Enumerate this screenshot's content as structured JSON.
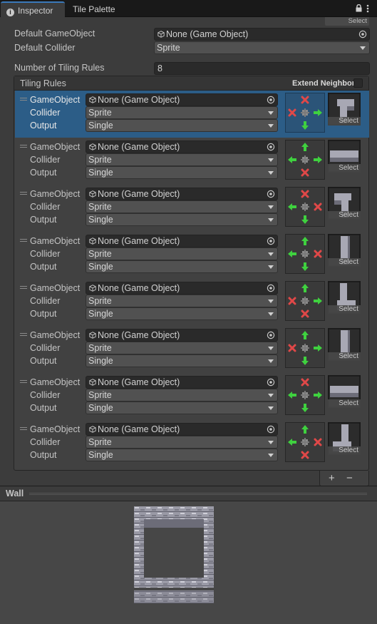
{
  "tabs": [
    {
      "label": "Inspector",
      "icon": "info-icon",
      "active": true
    },
    {
      "label": "Tile Palette",
      "active": false
    }
  ],
  "top_select_label": "Select",
  "fields": {
    "default_gameobject_label": "Default GameObject",
    "default_gameobject_value": "None (Game Object)",
    "default_collider_label": "Default Collider",
    "default_collider_value": "Sprite",
    "num_rules_label": "Number of Tiling Rules",
    "num_rules_value": "8"
  },
  "rules_panel": {
    "title": "Tiling Rules",
    "extend_neighbor_label": "Extend Neighbor",
    "extend_neighbor_checked": false
  },
  "rule_labels": {
    "gameobject": "GameObject",
    "collider": "Collider",
    "output": "Output"
  },
  "rules": [
    {
      "gameobject": "None (Game Object)",
      "collider": "Sprite",
      "output": "Single",
      "selected": true,
      "neighbors": {
        "n": "x",
        "w": "x",
        "e": "arrow",
        "s": "arrow"
      },
      "preview": "corner-top-left",
      "select_label": "Select"
    },
    {
      "gameobject": "None (Game Object)",
      "collider": "Sprite",
      "output": "Single",
      "selected": false,
      "neighbors": {
        "n": "arrow",
        "w": "arrow",
        "e": "arrow",
        "s": "x"
      },
      "preview": "edge-top",
      "select_label": "Select"
    },
    {
      "gameobject": "None (Game Object)",
      "collider": "Sprite",
      "output": "Single",
      "selected": false,
      "neighbors": {
        "n": "x",
        "w": "arrow",
        "e": "x",
        "s": "arrow"
      },
      "preview": "corner-top-right",
      "select_label": "Select"
    },
    {
      "gameobject": "None (Game Object)",
      "collider": "Sprite",
      "output": "Single",
      "selected": false,
      "neighbors": {
        "n": "arrow",
        "w": "arrow",
        "e": "x",
        "s": "arrow"
      },
      "preview": "edge-right",
      "select_label": "Select"
    },
    {
      "gameobject": "None (Game Object)",
      "collider": "Sprite",
      "output": "Single",
      "selected": false,
      "neighbors": {
        "n": "arrow",
        "w": "x",
        "e": "arrow",
        "s": "x"
      },
      "preview": "corner-bottom-left",
      "select_label": "Select"
    },
    {
      "gameobject": "None (Game Object)",
      "collider": "Sprite",
      "output": "Single",
      "selected": false,
      "neighbors": {
        "n": "arrow",
        "w": "x",
        "e": "arrow",
        "s": "arrow"
      },
      "preview": "edge-left",
      "select_label": "Select"
    },
    {
      "gameobject": "None (Game Object)",
      "collider": "Sprite",
      "output": "Single",
      "selected": false,
      "neighbors": {
        "n": "x",
        "w": "arrow",
        "e": "arrow",
        "s": "arrow"
      },
      "preview": "edge-bottom",
      "select_label": "Select"
    },
    {
      "gameobject": "None (Game Object)",
      "collider": "Sprite",
      "output": "Single",
      "selected": false,
      "neighbors": {
        "n": "arrow",
        "w": "arrow",
        "e": "x",
        "s": "x"
      },
      "preview": "corner-bottom-right",
      "select_label": "Select"
    }
  ],
  "list_buttons": {
    "add": "+",
    "remove": "−"
  },
  "preview_panel": {
    "title": "Wall"
  },
  "colors": {
    "accent_tab": "#3a79bb",
    "selected_row": "#2c5d87",
    "arrow_green": "#3fd13f",
    "x_red": "#e04848"
  }
}
